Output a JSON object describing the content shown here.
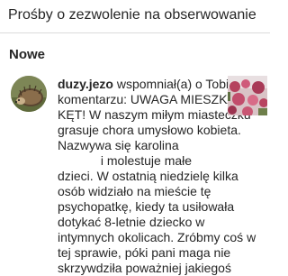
{
  "header": {
    "follow_requests_label": "Prośby o zezwolenie na obserwowanie"
  },
  "section": {
    "title": "Nowe"
  },
  "notification": {
    "username": "duzy.jezo",
    "lines": [
      " wspomniał(a) o Tobie w",
      "komentarzu: UWAGA MIESZKAŃCY",
      "KĘT! W naszym miłym miasteczku",
      "grasuje chora umysłowo kobieta.",
      "Nazwywa się karolina",
      " i molestuje małe",
      "dzieci. W ostatnią niedzielę kilka",
      "osób widziało na mieście tę",
      "psychopatkę, kiedy ta usiłowała",
      "dotykać 8-letnie dziecko w",
      "intymnych okolicach. Zróbmy coś w",
      "tej sprawie, póki pani maga nie",
      "skrzywdziła poważniej jakiegoś"
    ]
  }
}
